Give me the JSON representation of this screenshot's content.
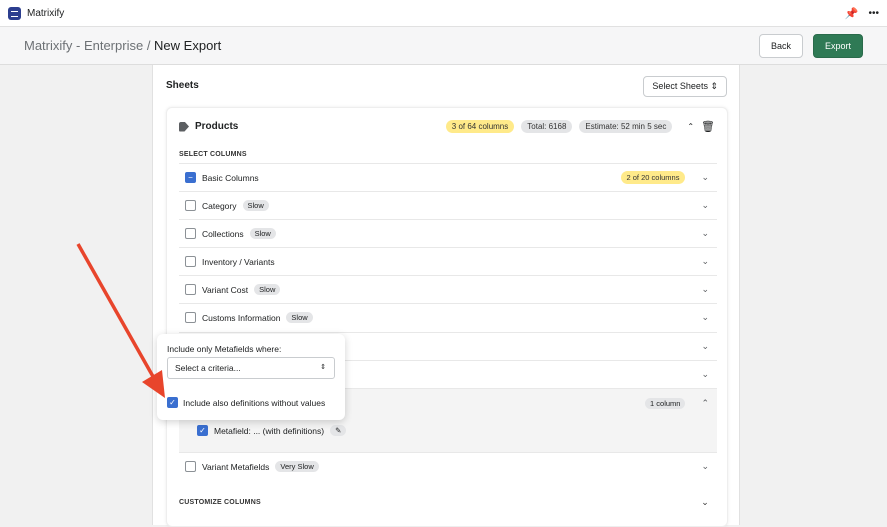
{
  "app": {
    "title": "Matrixify",
    "menu_icon": "ellipsis-icon",
    "pin_icon": "pin-icon"
  },
  "header": {
    "breadcrumb_parent": "Matrixify - Enterprise",
    "separator": " / ",
    "title": "New Export",
    "back": "Back",
    "export": "Export"
  },
  "sheets": {
    "title": "Sheets",
    "select": "Select Sheets"
  },
  "products": {
    "title": "Products",
    "columns_badge": "3 of 64 columns",
    "total": "Total: 6168",
    "estimate": "Estimate: 52 min 5 sec",
    "select_columns": "SELECT COLUMNS",
    "customize_columns": "CUSTOMIZE COLUMNS",
    "rows": [
      {
        "label": "Basic Columns",
        "badge": "",
        "count": "2 of 20 columns",
        "state": "partial"
      },
      {
        "label": "Category",
        "badge": "Slow"
      },
      {
        "label": "Collections",
        "badge": "Slow"
      },
      {
        "label": "Inventory / Variants",
        "badge": ""
      },
      {
        "label": "Variant Cost",
        "badge": "Slow"
      },
      {
        "label": "Customs Information",
        "badge": "Slow"
      }
    ],
    "expanded": {
      "count": "1 column",
      "child": "Metafield: ... (with definitions)"
    },
    "variant_metafields": {
      "label": "Variant Metafields",
      "badge": "Very Slow"
    }
  },
  "popover": {
    "label": "Include only Metafields where:",
    "select_placeholder": "Select a criteria...",
    "checkbox_label": "Include also definitions without values",
    "checked": true
  },
  "colors": {
    "accent": "#2f7a55",
    "checkbox": "#3a6fd0",
    "highlight": "#ffea8a",
    "arrow": "#e8452c"
  }
}
